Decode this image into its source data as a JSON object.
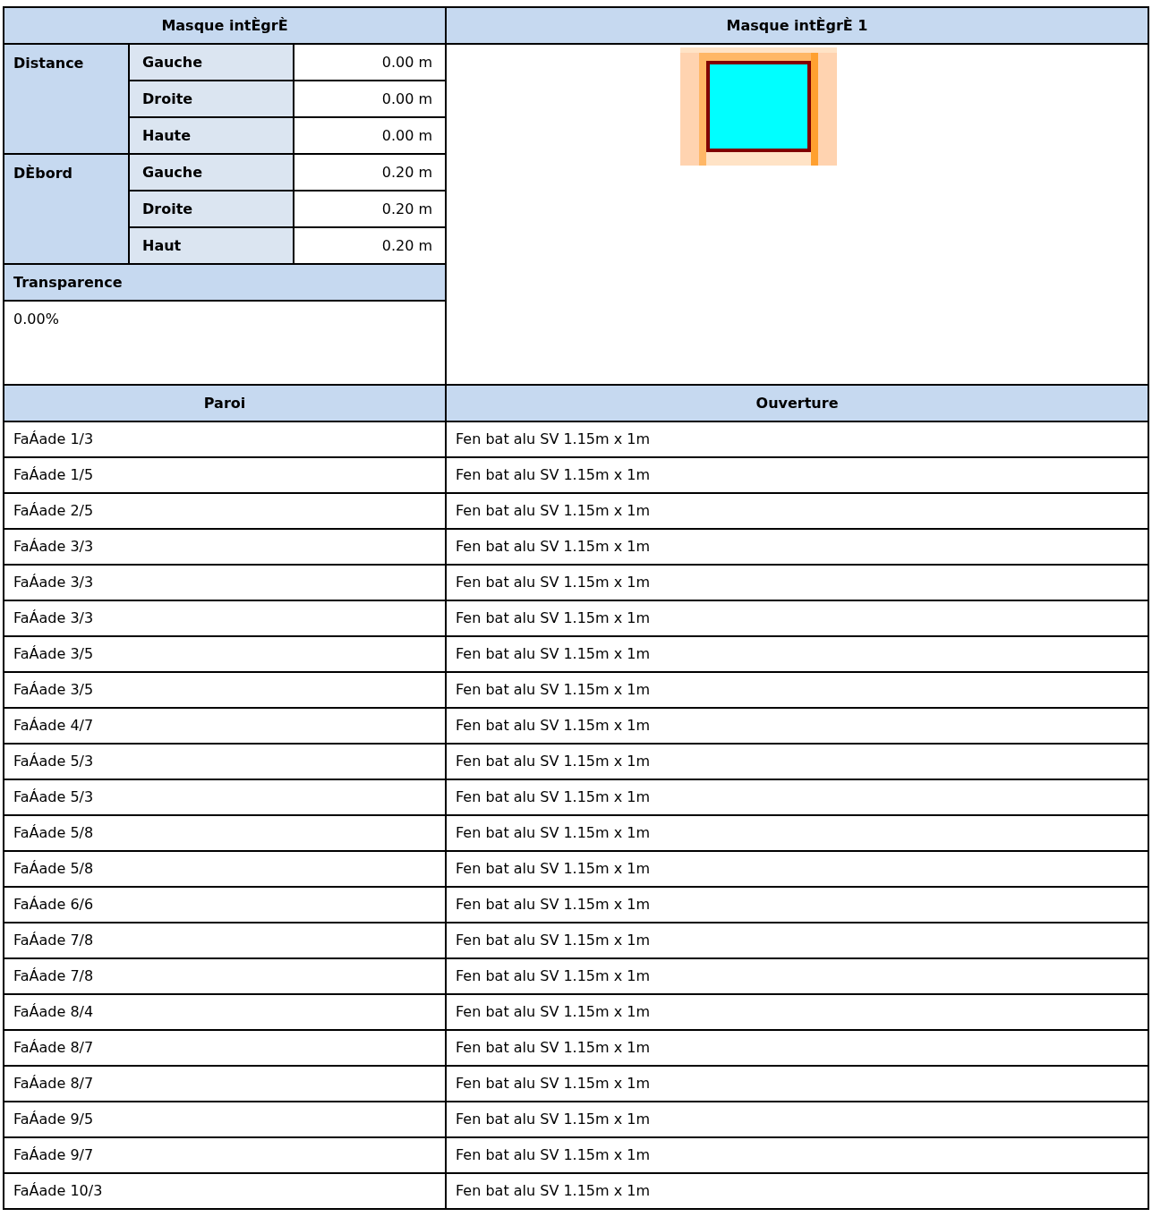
{
  "mask_panel": {
    "title": "Masque intÈgrÈ",
    "groups": [
      {
        "label": "Distance",
        "items": [
          {
            "label": "Gauche",
            "value": "0.00 m"
          },
          {
            "label": "Droite",
            "value": "0.00 m"
          },
          {
            "label": "Haute",
            "value": "0.00 m"
          }
        ]
      },
      {
        "label": "DÈbord",
        "items": [
          {
            "label": "Gauche",
            "value": "0.20 m"
          },
          {
            "label": "Droite",
            "value": "0.20 m"
          },
          {
            "label": "Haut",
            "value": "0.20 m"
          }
        ]
      }
    ],
    "transparence": {
      "label": "Transparence",
      "value": "0.00%"
    }
  },
  "preview": {
    "title": "Masque intÈgrÈ 1"
  },
  "table": {
    "columns": [
      "Paroi",
      "Ouverture"
    ],
    "rows": [
      [
        "FaÁade 1/3",
        "Fen bat alu SV 1.15m x 1m"
      ],
      [
        "FaÁade 1/5",
        "Fen bat alu SV 1.15m x 1m"
      ],
      [
        "FaÁade 2/5",
        "Fen bat alu SV 1.15m x 1m"
      ],
      [
        "FaÁade 3/3",
        "Fen bat alu SV 1.15m x 1m"
      ],
      [
        "FaÁade 3/3",
        "Fen bat alu SV 1.15m x 1m"
      ],
      [
        "FaÁade 3/3",
        "Fen bat alu SV 1.15m x 1m"
      ],
      [
        "FaÁade 3/5",
        "Fen bat alu SV 1.15m x 1m"
      ],
      [
        "FaÁade 3/5",
        "Fen bat alu SV 1.15m x 1m"
      ],
      [
        "FaÁade 4/7",
        "Fen bat alu SV 1.15m x 1m"
      ],
      [
        "FaÁade 5/3",
        "Fen bat alu SV 1.15m x 1m"
      ],
      [
        "FaÁade 5/3",
        "Fen bat alu SV 1.15m x 1m"
      ],
      [
        "FaÁade 5/8",
        "Fen bat alu SV 1.15m x 1m"
      ],
      [
        "FaÁade 5/8",
        "Fen bat alu SV 1.15m x 1m"
      ],
      [
        "FaÁade 6/6",
        "Fen bat alu SV 1.15m x 1m"
      ],
      [
        "FaÁade 7/8",
        "Fen bat alu SV 1.15m x 1m"
      ],
      [
        "FaÁade 7/8",
        "Fen bat alu SV 1.15m x 1m"
      ],
      [
        "FaÁade 8/4",
        "Fen bat alu SV 1.15m x 1m"
      ],
      [
        "FaÁade 8/7",
        "Fen bat alu SV 1.15m x 1m"
      ],
      [
        "FaÁade 8/7",
        "Fen bat alu SV 1.15m x 1m"
      ],
      [
        "FaÁade 9/5",
        "Fen bat alu SV 1.15m x 1m"
      ],
      [
        "FaÁade 9/7",
        "Fen bat alu SV 1.15m x 1m"
      ],
      [
        "FaÁade 10/3",
        "Fen bat alu SV 1.15m x 1m"
      ]
    ]
  }
}
